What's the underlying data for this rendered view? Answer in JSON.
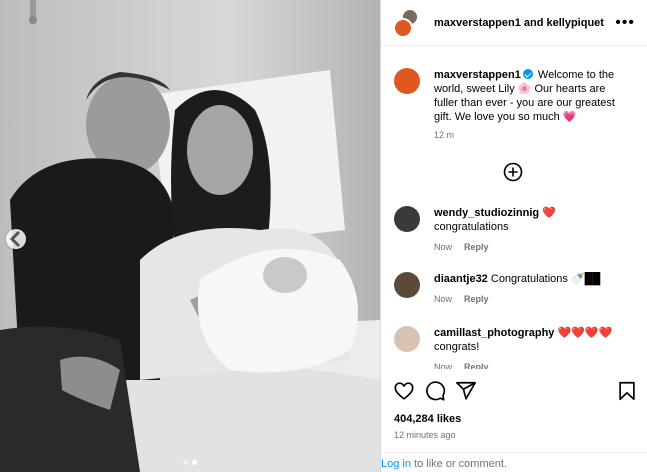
{
  "header": {
    "title": "maxverstappen1 and kellypiquet",
    "more": "•••"
  },
  "caption": {
    "username": "maxverstappen1",
    "text": " Welcome to the world, sweet Lily 🌸 Our hearts are fuller than ever - you are our greatest gift. We love you so much 💗",
    "time": "12 m"
  },
  "comments": [
    {
      "username": "wendy_studiozinnig",
      "text": " ❤️",
      "line2": "congratulations",
      "time": "Now",
      "reply": "Reply",
      "avatar_color": "#3a3a3a"
    },
    {
      "username": "diaantje32",
      "text": " Congratulations 🍼██",
      "line2": "",
      "time": "Now",
      "reply": "Reply",
      "avatar_color": "#5b4a3a"
    },
    {
      "username": "camillast_photography",
      "text": " ❤️❤️❤️❤️",
      "line2": "congrats!",
      "time": "Now",
      "reply": "Reply",
      "avatar_color": "#d9c2b0"
    }
  ],
  "likes": "404,284 likes",
  "posted": "12 minutes ago",
  "footer": {
    "login": "Log in",
    "rest": " to like or comment."
  },
  "carousel": {
    "current": 2,
    "total": 2
  }
}
